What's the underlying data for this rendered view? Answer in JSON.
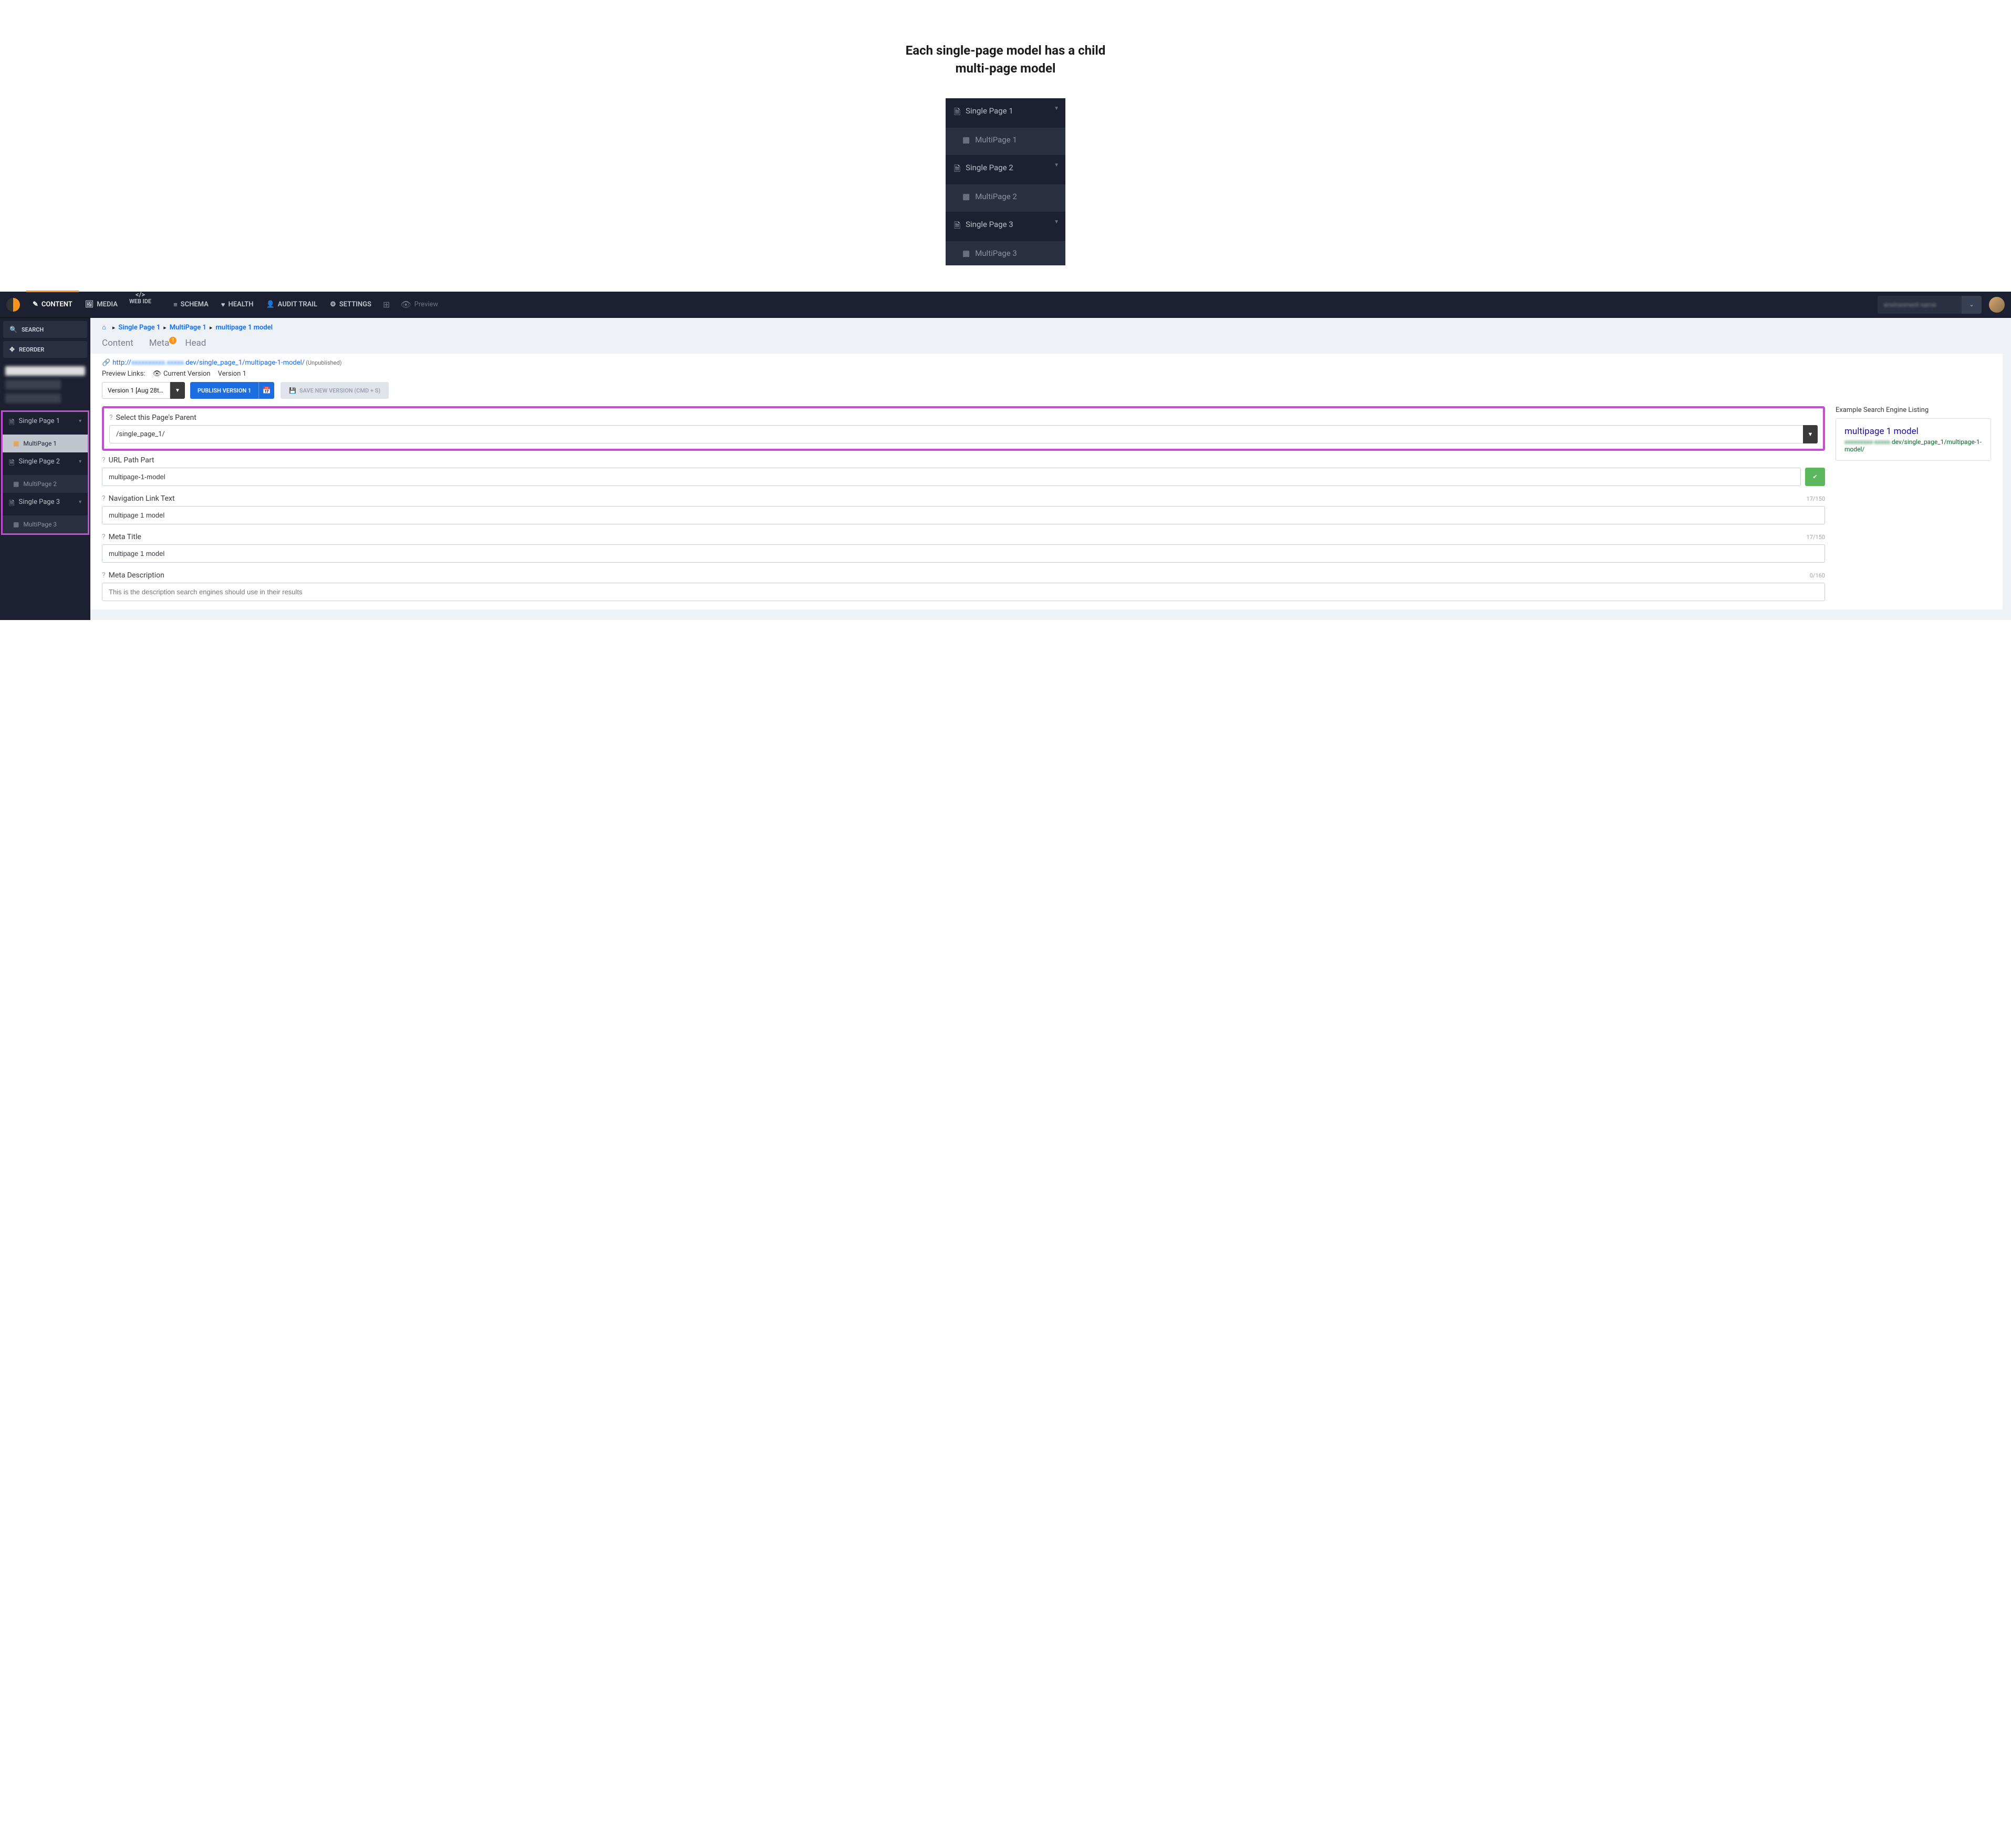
{
  "intro_heading": "Each single-page model has a child multi-page model",
  "tree": [
    {
      "parent": "Single Page 1",
      "child": "MultiPage 1"
    },
    {
      "parent": "Single Page 2",
      "child": "MultiPage 2"
    },
    {
      "parent": "Single Page 3",
      "child": "MultiPage 3"
    }
  ],
  "topbar": {
    "items": {
      "content": "CONTENT",
      "media": "MEDIA",
      "webide": "WEB IDE",
      "schema": "SCHEMA",
      "health": "HEALTH",
      "audit": "AUDIT TRAIL",
      "settings": "SETTINGS",
      "preview": "Preview"
    }
  },
  "sidebar": {
    "search": "SEARCH",
    "reorder": "REORDER",
    "tree": [
      {
        "parent": "Single Page 1",
        "child": "MultiPage 1",
        "active": true
      },
      {
        "parent": "Single Page 2",
        "child": "MultiPage 2",
        "active": false
      },
      {
        "parent": "Single Page 3",
        "child": "MultiPage 3",
        "active": false
      }
    ]
  },
  "breadcrumb": {
    "a": "Single Page 1",
    "b": "MultiPage 1",
    "c": "multipage 1 model"
  },
  "tabs": {
    "content": "Content",
    "meta": "Meta",
    "head": "Head"
  },
  "url": {
    "prefix": "http://",
    "mid": "dev/single_page_1/multipage-1-model/",
    "unpublished": "(Unpublished)"
  },
  "preview_links": {
    "label": "Preview Links:",
    "current": "Current Version",
    "v1": "Version 1"
  },
  "actions": {
    "version_select": "Version 1 [Aug 28th 2...",
    "publish": "PUBLISH VERSION 1",
    "save": "SAVE NEW VERSION (CMD + S)"
  },
  "fields": {
    "parent": {
      "label": "Select this Page's Parent",
      "value": "/single_page_1/"
    },
    "url_path": {
      "label": "URL Path Part",
      "value": "multipage-1-model"
    },
    "nav_text": {
      "label": "Navigation Link Text",
      "value": "multipage 1 model",
      "count": "17/150"
    },
    "meta_title": {
      "label": "Meta Title",
      "value": "multipage 1 model",
      "count": "17/150"
    },
    "meta_desc": {
      "label": "Meta Description",
      "placeholder": "This is the description search engines should use in their results",
      "count": "0/160"
    }
  },
  "serp": {
    "heading": "Example Search Engine Listing",
    "title": "multipage 1 model",
    "url_suffix": "dev/single_page_1/multipage-1-model/"
  }
}
